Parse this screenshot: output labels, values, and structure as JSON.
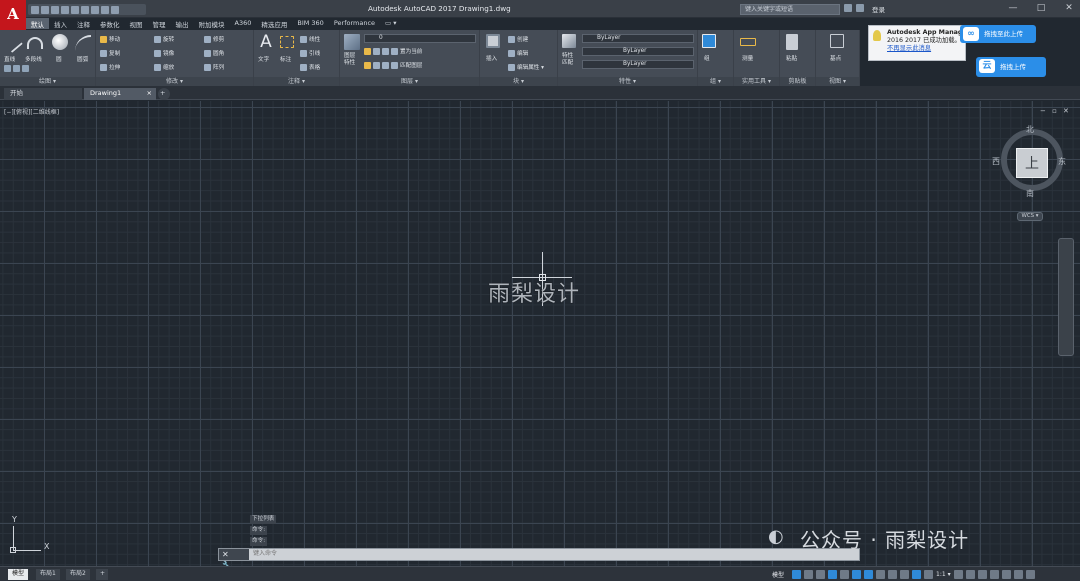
{
  "app": {
    "logo_letter": "A",
    "window_title": "Autodesk AutoCAD 2017     Drawing1.dwg",
    "search_placeholder": "键入关键字或短语",
    "login": "登录",
    "win_minimize": "—",
    "win_maximize": "□",
    "win_close": "✕"
  },
  "ribbon_tabs": [
    "默认",
    "插入",
    "注释",
    "参数化",
    "视图",
    "管理",
    "输出",
    "附加模块",
    "A360",
    "精选应用",
    "BIM 360",
    "Performance",
    "▭ ▾"
  ],
  "ribbon": {
    "draw": {
      "title": "绘图 ▾",
      "line": "直线",
      "polyline": "多段线",
      "circle": "圆",
      "arc": "圆弧"
    },
    "modify": {
      "title": "修改 ▾",
      "move": "移动",
      "rotate": "旋转",
      "trim": "修剪",
      "copy": "复制",
      "mirror": "镜像",
      "fillet": "圆角",
      "stretch": "拉伸",
      "scale": "缩放",
      "array": "阵列"
    },
    "annotation": {
      "title": "注释 ▾",
      "text": "文字",
      "dimension": "标注",
      "linear": "线性",
      "leader": "引线",
      "table": "表格"
    },
    "layers": {
      "title": "图层 ▾",
      "layer_props": "图层\n特性",
      "current_layer": "0",
      "make_current": "置为当前",
      "match_layer": "匹配图层"
    },
    "block": {
      "title": "块 ▾",
      "insert": "插入",
      "create": "创建",
      "edit": "编辑",
      "edit_attr": "编辑属性 ▾"
    },
    "properties": {
      "title": "特性 ▾",
      "match": "特性\n匹配",
      "color": "ByLayer",
      "linetype": "ByLayer",
      "lineweight": "ByLayer"
    },
    "groups": {
      "title": "组 ▾",
      "group": "组"
    },
    "utilities": {
      "title": "实用工具 ▾",
      "measure": "测量"
    },
    "clipboard": {
      "title": "剪贴板",
      "paste": "粘贴"
    },
    "view": {
      "title": "视图 ▾",
      "base": "基点"
    }
  },
  "doc_tabs": [
    "开始",
    "Drawing1"
  ],
  "doc_tab_close": "×",
  "doc_tab_add": "+",
  "viewport": {
    "label": "[−][俯视][二维线框]",
    "controls": "− ▫ ✕"
  },
  "viewcube": {
    "north": "北",
    "south": "南",
    "east": "东",
    "west": "西",
    "face": "上",
    "wcs": "WCS ▾"
  },
  "ucs": {
    "x": "X",
    "y": "Y"
  },
  "canvas_watermark": "雨梨设计",
  "command_history": [
    "下拉列表",
    "命令:",
    "命令:"
  ],
  "command": {
    "buttons": "✕ 🔧",
    "prompt": "键入命令"
  },
  "wechat_watermark": "公众号 · 雨梨设计",
  "status": {
    "layout_tabs": [
      "模型",
      "布局1",
      "布局2"
    ],
    "add_tab": "+",
    "model_label": "模型",
    "scale": "1:1 ▾"
  },
  "popup": {
    "title": "Autodesk App Manager",
    "line2": "2016 2017 已成功加载。",
    "link": "不再显示此消息"
  },
  "baidu": {
    "upload": "拖拽至此上传",
    "drag_upload": "拖拽上传"
  },
  "colors": {
    "canvas_bg": "#212830",
    "ribbon_bg": "#454c56",
    "accent_red": "#c4161c",
    "baidu_blue": "#2b8ee8"
  }
}
